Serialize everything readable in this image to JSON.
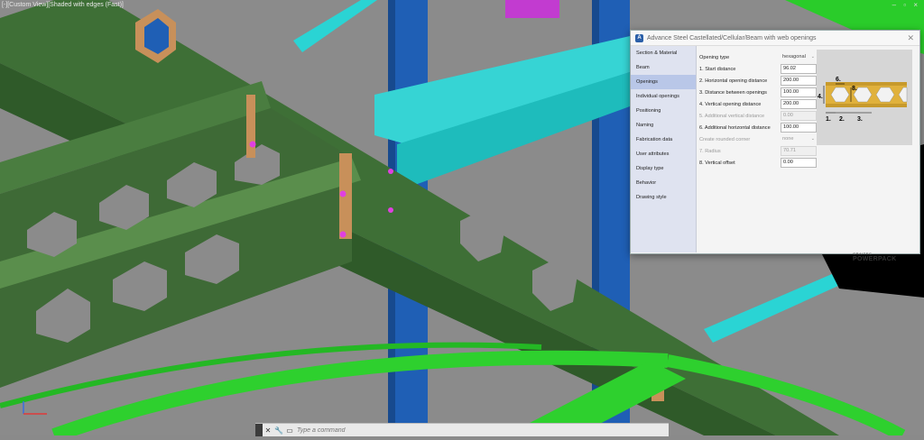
{
  "viewport": {
    "label": "[-][Custom View][Shaded with edges (Fast)]",
    "window_controls": "– ▫ ×"
  },
  "dialog": {
    "app": "Advance Steel",
    "title": "Castellated/Cellular/Beam with web openings",
    "title_full": "Advance Steel   Castellated/Cellular/Beam with web openings",
    "nav": [
      {
        "label": "Section & Material"
      },
      {
        "label": "Beam"
      },
      {
        "label": "Openings",
        "active": true
      },
      {
        "label": "Individual openings"
      },
      {
        "label": "Positioning"
      },
      {
        "label": "Naming"
      },
      {
        "label": "Fabrication data"
      },
      {
        "label": "User attributes"
      },
      {
        "label": "Display type"
      },
      {
        "label": "Behavior"
      },
      {
        "label": "Drawing style"
      }
    ],
    "fields": {
      "opening_type": {
        "label": "Opening type",
        "value": "hexagonal"
      },
      "start_distance": {
        "label": "1. Start distance",
        "value": "96.02"
      },
      "horizontal_opening_distance": {
        "label": "2. Horizontal opening distance",
        "value": "200.00"
      },
      "distance_between_openings": {
        "label": "3. Distance between openings",
        "value": "100.00"
      },
      "vertical_opening_distance": {
        "label": "4. Vertical opening distance",
        "value": "200.00"
      },
      "additional_vertical_distance": {
        "label": "5. Additional vertical distance",
        "value": "0.00"
      },
      "additional_horizontal_distance": {
        "label": "6. Additional horizontal distance",
        "value": "100.00"
      },
      "create_rounded_corner": {
        "label": "Create rounded corner",
        "value": "none"
      },
      "radius": {
        "label": "7. Radius",
        "value": "70.71"
      },
      "vertical_offset": {
        "label": "8. Vertical offset",
        "value": "0.00"
      }
    },
    "preview_labels": [
      "6.",
      "8.",
      "4.",
      "1.",
      "2.",
      "3."
    ],
    "brand": {
      "line1": "GRAITEC",
      "line2": "POWERPACK"
    }
  },
  "command_line": {
    "placeholder": "Type a command"
  },
  "colors": {
    "ground": "#8a8a8a",
    "beam_green": "#3d6e35",
    "beam_green_light": "#2ecc2e",
    "column_blue": "#1e5fb0",
    "cyan": "#36d6d6",
    "plate": "#c8905a",
    "bolt": "#e040e0"
  }
}
